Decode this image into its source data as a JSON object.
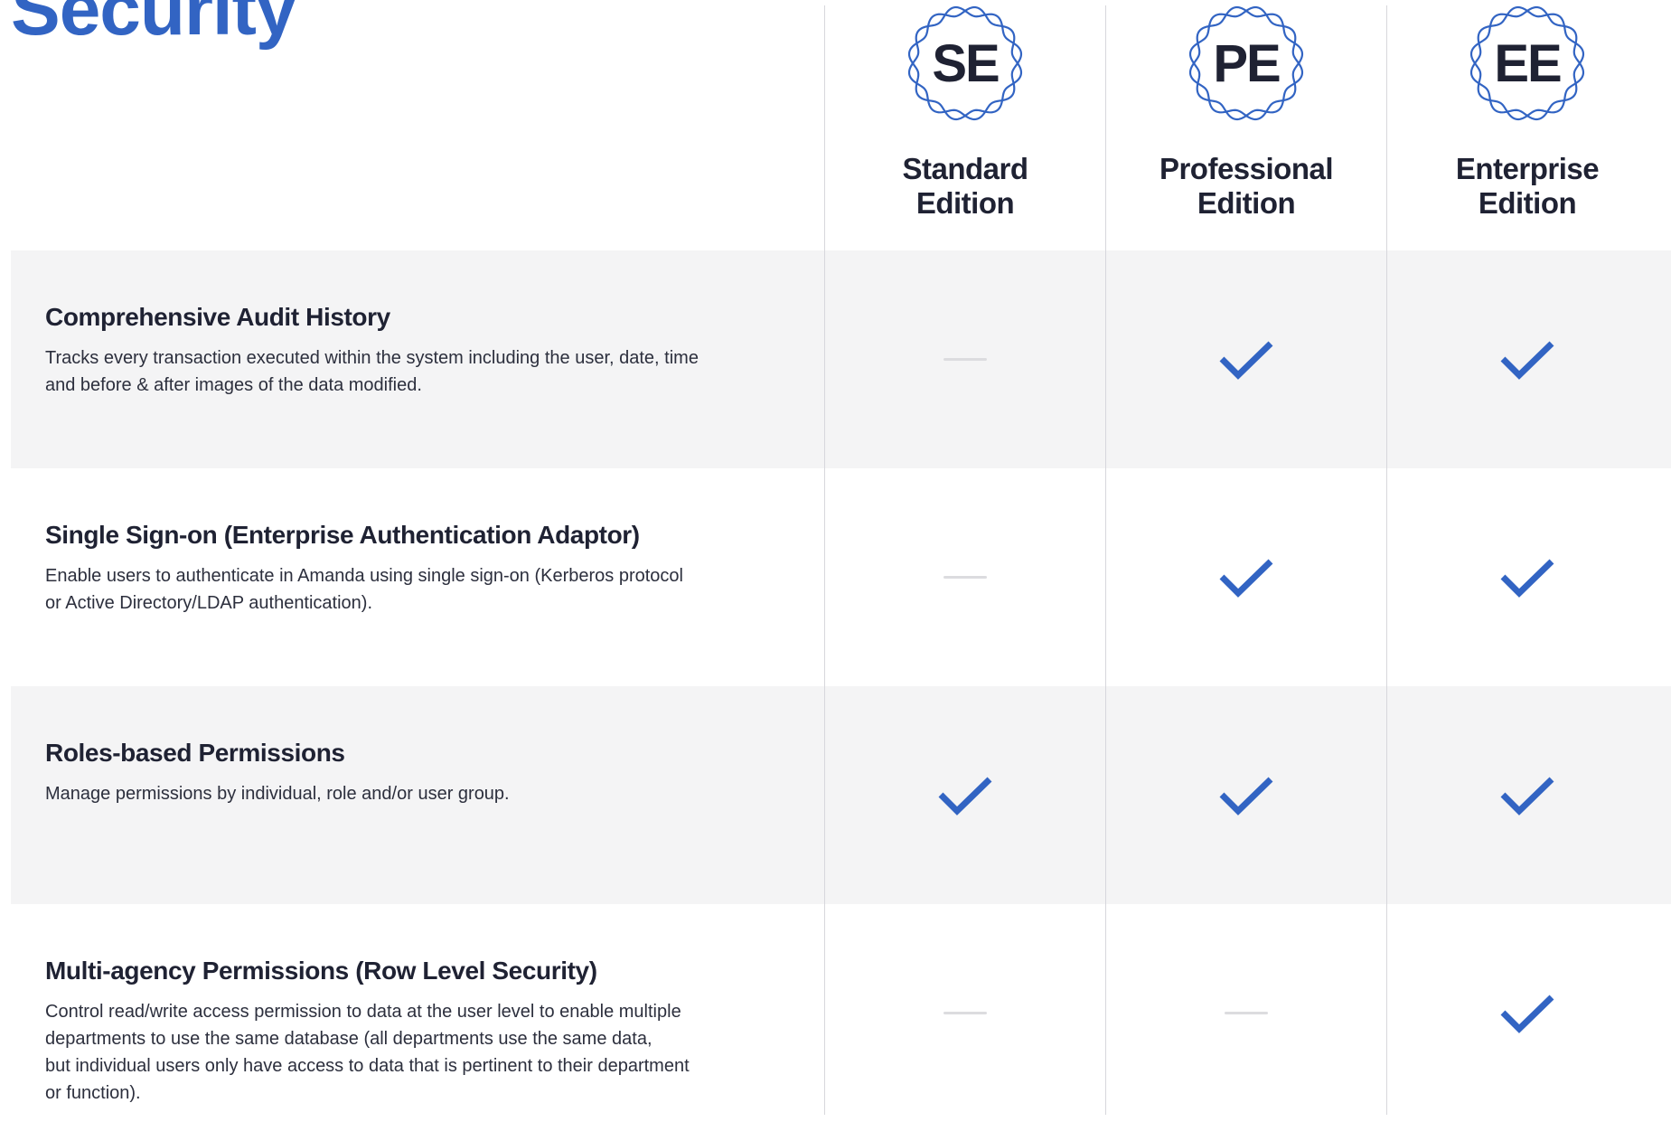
{
  "page": {
    "title": "Security"
  },
  "colors": {
    "accent": "#3264c3",
    "text": "#1f2233",
    "shaded_row": "#f4f4f5",
    "divider": "#d7d7dc",
    "dash": "#dcdcdf"
  },
  "editions": [
    {
      "abbr": "SE",
      "name_line1": "Standard",
      "name_line2": "Edition",
      "badge_icon": "rosette-badge-icon"
    },
    {
      "abbr": "PE",
      "name_line1": "Professional",
      "name_line2": "Edition",
      "badge_icon": "rosette-badge-icon"
    },
    {
      "abbr": "EE",
      "name_line1": "Enterprise",
      "name_line2": "Edition",
      "badge_icon": "rosette-badge-icon"
    }
  ],
  "features": [
    {
      "title": "Comprehensive Audit History",
      "desc_lines": [
        "Tracks every transaction executed within the system including the user, date, time",
        "and before & after images of the data modified."
      ],
      "availability": [
        false,
        true,
        true
      ]
    },
    {
      "title": "Single Sign-on (Enterprise Authentication Adaptor)",
      "desc_lines": [
        "Enable users to authenticate in Amanda using single sign-on (Kerberos protocol",
        "or Active Directory/LDAP authentication)."
      ],
      "availability": [
        false,
        true,
        true
      ]
    },
    {
      "title": "Roles-based Permissions",
      "desc_lines": [
        "Manage permissions by individual, role and/or user group."
      ],
      "availability": [
        true,
        true,
        true
      ]
    },
    {
      "title": "Multi-agency Permissions (Row Level Security)",
      "desc_lines": [
        "Control read/write access permission to data at the user level to enable multiple",
        "departments to use the same database (all departments use the same data,",
        "but individual users only have access to data that is pertinent to their department",
        "or function)."
      ],
      "availability": [
        false,
        false,
        true
      ]
    }
  ],
  "icons": {
    "included": "checkmark-icon",
    "not_included": "dash-icon"
  }
}
